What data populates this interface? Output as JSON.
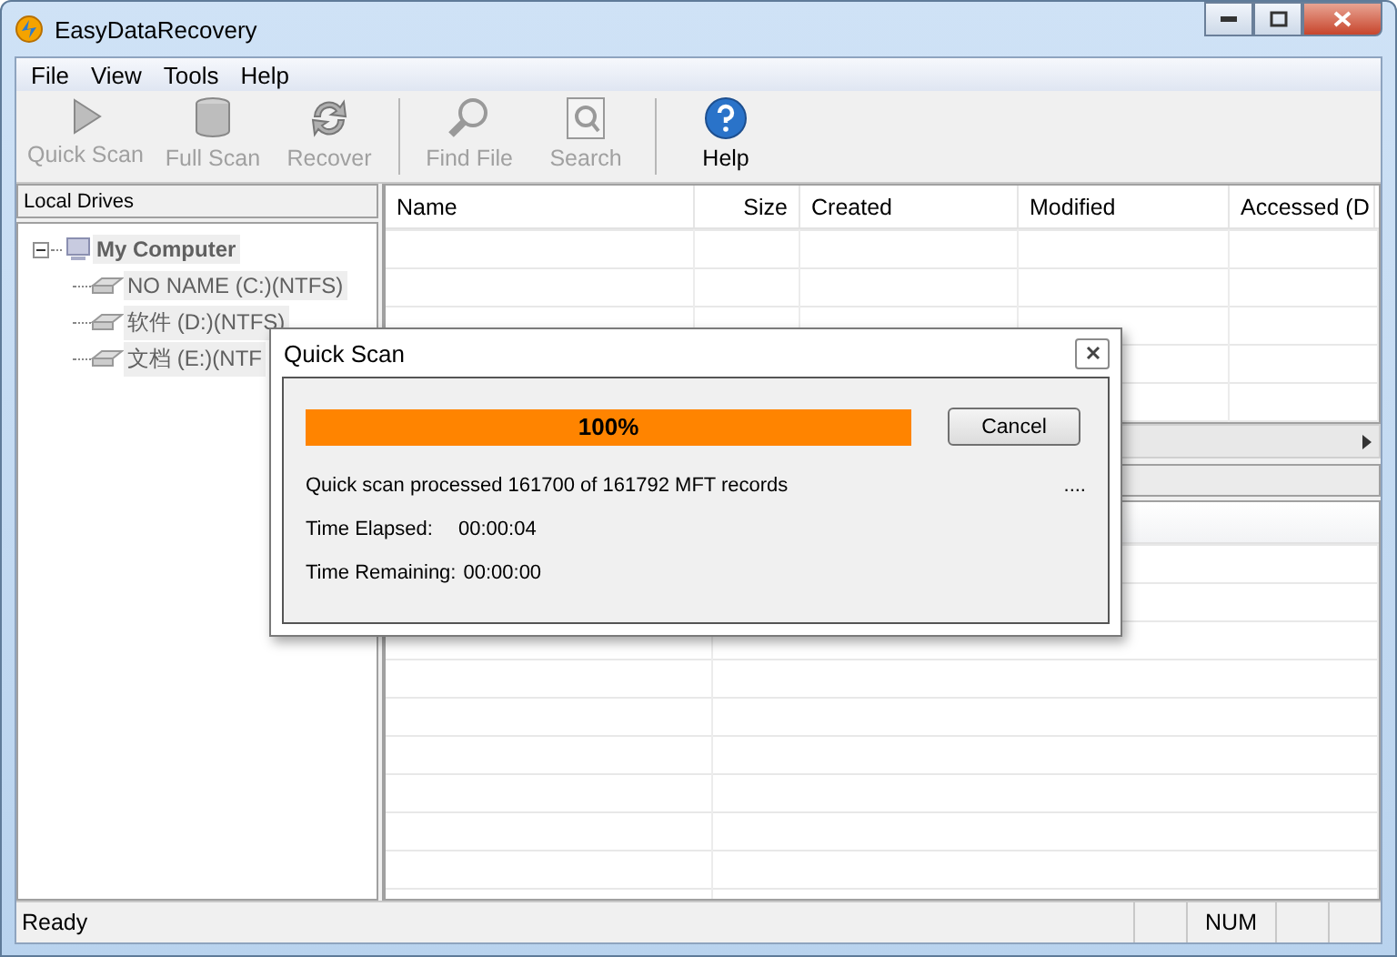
{
  "window": {
    "title": "EasyDataRecovery"
  },
  "menu": [
    "File",
    "View",
    "Tools",
    "Help"
  ],
  "toolbar": [
    [
      {
        "kind": "play",
        "label": "Quick Scan",
        "disabled": true
      },
      {
        "kind": "drive",
        "label": "Full Scan",
        "disabled": true
      },
      {
        "kind": "recover",
        "label": "Recover",
        "disabled": true
      }
    ],
    [
      {
        "kind": "find",
        "label": "Find File",
        "disabled": true
      },
      {
        "kind": "search",
        "label": "Search",
        "disabled": true
      }
    ],
    [
      {
        "kind": "help",
        "label": "Help",
        "disabled": false
      }
    ]
  ],
  "sidebar": {
    "title": "Local Drives",
    "tree": [
      {
        "label": "My Computer",
        "kind": "computer",
        "expanded": true,
        "children": [
          {
            "label": "NO NAME (C:)(NTFS)",
            "kind": "drive"
          },
          {
            "label": "软件 (D:)(NTFS)",
            "kind": "drive"
          },
          {
            "label": "文档 (E:)(NTF",
            "kind": "drive"
          }
        ]
      }
    ]
  },
  "table": {
    "columns": [
      "Name",
      "Size",
      "Created",
      "Modified",
      "Accessed (D"
    ]
  },
  "dialog": {
    "title": "Quick Scan",
    "progress": {
      "level": 1.0,
      "label": "100%"
    },
    "button": "Cancel",
    "status": "Quick scan processed 161700 of 161792 MFT records",
    "dots": "....",
    "lines": [
      {
        "label": "Time Elapsed:",
        "value": "00:00:04"
      },
      {
        "label": "Time Remaining:",
        "value": "00:00:00"
      }
    ]
  },
  "status_bar": {
    "text": "Ready",
    "indicators": [
      "NUM"
    ]
  }
}
